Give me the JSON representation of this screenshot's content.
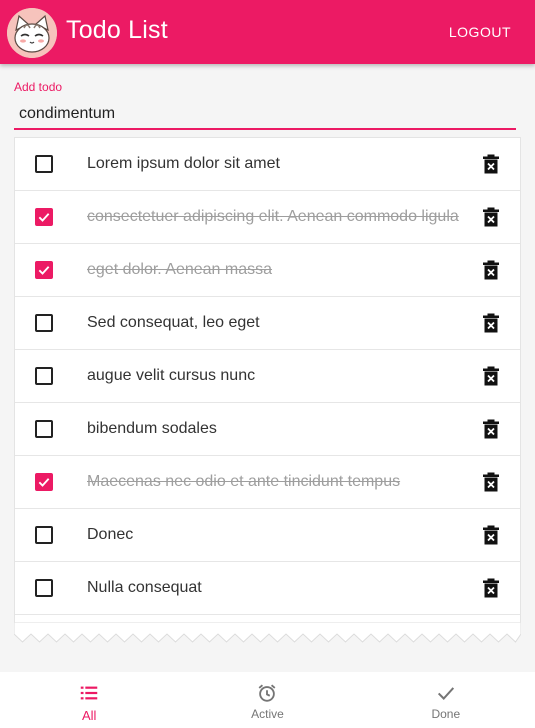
{
  "appbar": {
    "title": "Todo List",
    "logout_label": "LOGOUT",
    "color": "#ec1a64"
  },
  "add_todo": {
    "label": "Add todo",
    "value": "condimentum"
  },
  "todos": [
    {
      "text": "Lorem ipsum dolor sit amet",
      "done": false
    },
    {
      "text": "consectetuer adipiscing elit. Aenean commodo ligula",
      "done": true
    },
    {
      "text": "eget dolor. Aenean massa",
      "done": true
    },
    {
      "text": "Sed consequat, leo eget",
      "done": false
    },
    {
      "text": "augue velit cursus nunc",
      "done": false
    },
    {
      "text": "bibendum sodales",
      "done": false
    },
    {
      "text": "Maecenas nec odio et ante tincidunt tempus",
      "done": true
    },
    {
      "text": "Donec",
      "done": false
    },
    {
      "text": "Nulla consequat",
      "done": false
    }
  ],
  "bottom_nav": {
    "items": [
      {
        "label": "All",
        "icon": "list-icon",
        "active": true
      },
      {
        "label": "Active",
        "icon": "alarm-clock-icon",
        "active": false
      },
      {
        "label": "Done",
        "icon": "check-icon",
        "active": false
      }
    ]
  }
}
